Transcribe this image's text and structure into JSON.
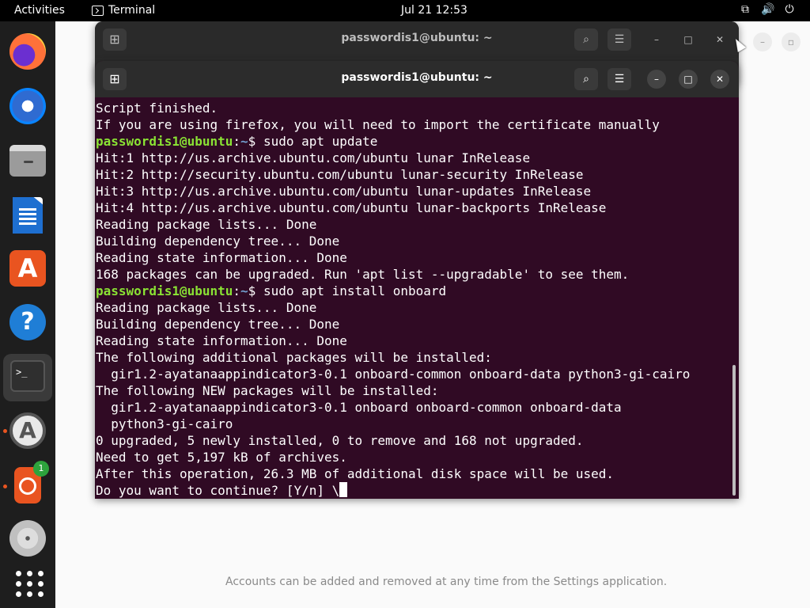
{
  "topbar": {
    "activities": "Activities",
    "app_name": "Terminal",
    "clock": "Jul 21  12:53"
  },
  "dock": {
    "items": [
      "Firefox",
      "Thunderbird",
      "Files",
      "LibreOffice Writer",
      "Ubuntu Software",
      "Help",
      "Terminal",
      "Software Updater",
      "Ubuntu Pro",
      "Disc",
      "Show Applications"
    ],
    "ubuntu_badge": "1",
    "terminal_glyph": ">_"
  },
  "background_window": {
    "footer_text": "Accounts can be added and removed at any time from the Settings application."
  },
  "terminal_back": {
    "title": "passwordis1@ubuntu: ~"
  },
  "terminal_front": {
    "title": "passwordis1@ubuntu: ~",
    "prompt_user": "passwordis1@ubuntu",
    "prompt_path": "~",
    "lines": [
      {
        "text": "Script finished."
      },
      {
        "text": "If you are using firefox, you will need to import the certificate manually"
      },
      {
        "prompt": true,
        "cmd": "$ sudo apt update"
      },
      {
        "text": "Hit:1 http://us.archive.ubuntu.com/ubuntu lunar InRelease"
      },
      {
        "text": "Hit:2 http://security.ubuntu.com/ubuntu lunar-security InRelease"
      },
      {
        "text": "Hit:3 http://us.archive.ubuntu.com/ubuntu lunar-updates InRelease"
      },
      {
        "text": "Hit:4 http://us.archive.ubuntu.com/ubuntu lunar-backports InRelease"
      },
      {
        "text": "Reading package lists... Done"
      },
      {
        "text": "Building dependency tree... Done"
      },
      {
        "text": "Reading state information... Done"
      },
      {
        "text": "168 packages can be upgraded. Run 'apt list --upgradable' to see them."
      },
      {
        "prompt": true,
        "cmd": "$ sudo apt install onboard"
      },
      {
        "text": "Reading package lists... Done"
      },
      {
        "text": "Building dependency tree... Done"
      },
      {
        "text": "Reading state information... Done"
      },
      {
        "text": "The following additional packages will be installed:"
      },
      {
        "text": "  gir1.2-ayatanaappindicator3-0.1 onboard-common onboard-data python3-gi-cairo"
      },
      {
        "text": "The following NEW packages will be installed:"
      },
      {
        "text": "  gir1.2-ayatanaappindicator3-0.1 onboard onboard-common onboard-data"
      },
      {
        "text": "  python3-gi-cairo"
      },
      {
        "text": "0 upgraded, 5 newly installed, 0 to remove and 168 not upgraded."
      },
      {
        "text": "Need to get 5,197 kB of archives."
      },
      {
        "text": "After this operation, 26.3 MB of additional disk space will be used."
      },
      {
        "text": "Do you want to continue? [Y/n] \\",
        "cursor": true
      }
    ]
  },
  "icons": {
    "new_tab": "new-tab-icon",
    "search": "search-icon",
    "menu": "hamburger-menu-icon",
    "minimize": "minimize-icon",
    "maximize": "maximize-icon",
    "close": "close-icon"
  }
}
